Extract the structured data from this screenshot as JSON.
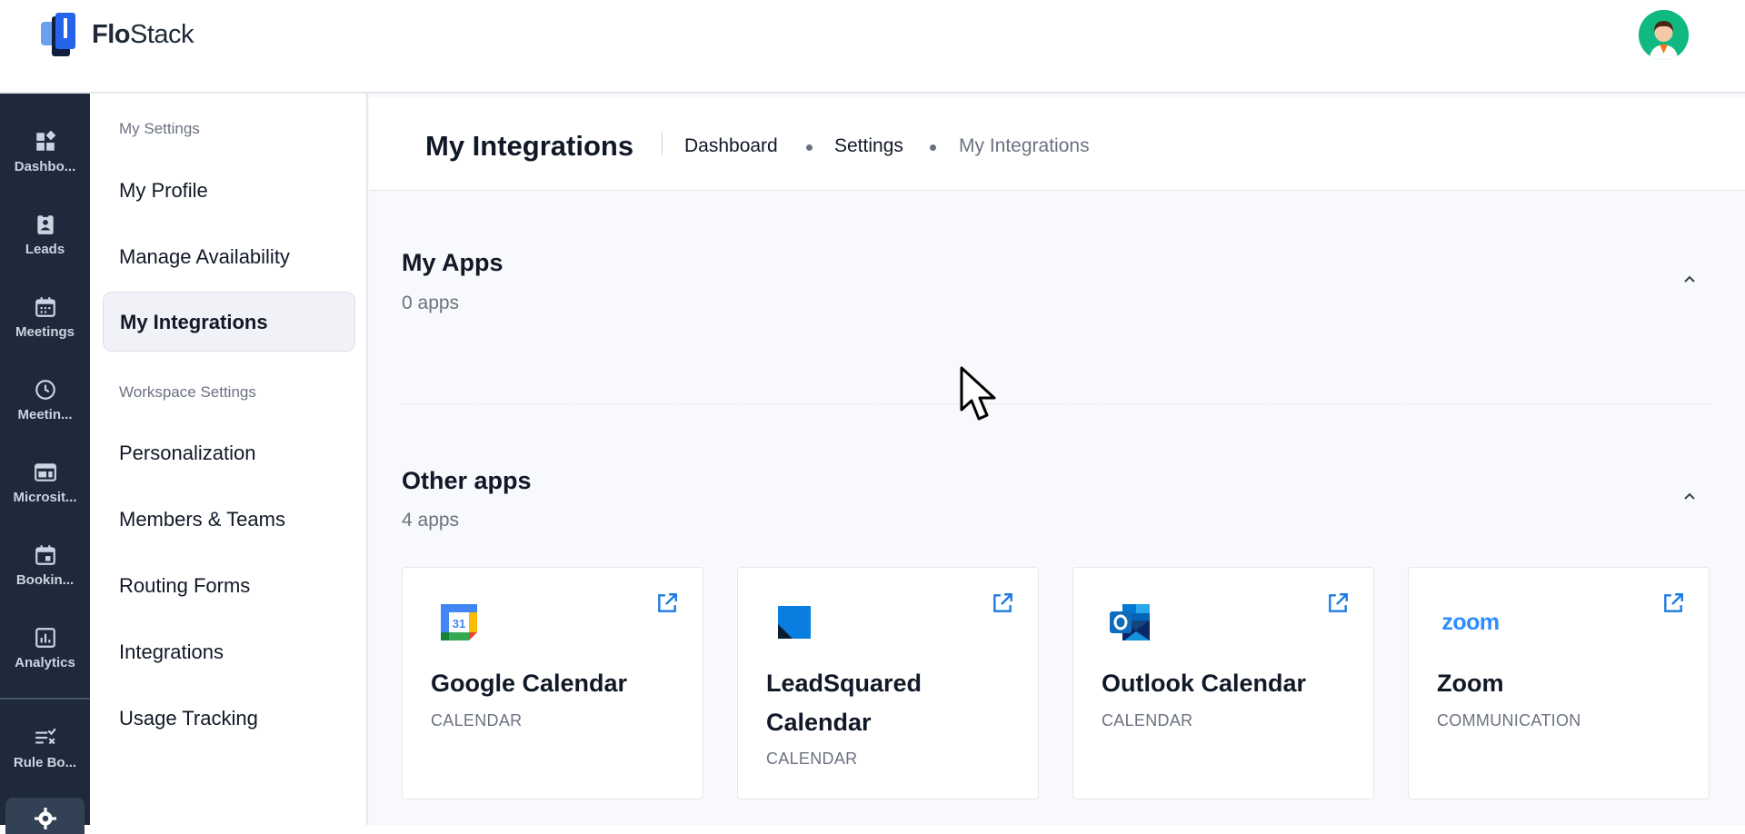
{
  "brand": {
    "name_bold": "Flo",
    "name_rest": "Stack"
  },
  "rail": {
    "items": [
      {
        "label": "Dashbo...",
        "icon": "dashboard-icon"
      },
      {
        "label": "Leads",
        "icon": "clipboard-user-icon"
      },
      {
        "label": "Meetings",
        "icon": "calendar-icon"
      },
      {
        "label": "Meetin...",
        "icon": "clock-icon"
      },
      {
        "label": "Microsit...",
        "icon": "web-layout-icon"
      },
      {
        "label": "Bookin...",
        "icon": "calendar-event-icon"
      },
      {
        "label": "Analytics",
        "icon": "bar-chart-icon"
      },
      {
        "label": "Rule Bo...",
        "icon": "rule-list-icon"
      }
    ]
  },
  "sidebar": {
    "section_my": "My Settings",
    "my_items": [
      "My Profile",
      "Manage Availability",
      "My Integrations"
    ],
    "active": "My Integrations",
    "section_workspace": "Workspace Settings",
    "workspace_items": [
      "Personalization",
      "Members & Teams",
      "Routing Forms",
      "Integrations",
      "Usage Tracking"
    ]
  },
  "header": {
    "title": "My Integrations",
    "breadcrumb": [
      "Dashboard",
      "Settings",
      "My Integrations"
    ]
  },
  "my_apps": {
    "title": "My Apps",
    "count": "0 apps"
  },
  "other_apps": {
    "title": "Other apps",
    "count": "4 apps",
    "cards": [
      {
        "name": "Google Calendar",
        "category": "CALENDAR",
        "icon": "google-calendar-icon"
      },
      {
        "name": "LeadSquared Calendar",
        "category": "CALENDAR",
        "icon": "leadsquared-icon"
      },
      {
        "name": "Outlook Calendar",
        "category": "CALENDAR",
        "icon": "outlook-icon"
      },
      {
        "name": "Zoom",
        "category": "COMMUNICATION",
        "icon": "zoom-icon"
      }
    ]
  },
  "colors": {
    "rail_bg": "#1e293b",
    "accent": "#1d7ae0",
    "avatar_bg": "#10b981"
  }
}
